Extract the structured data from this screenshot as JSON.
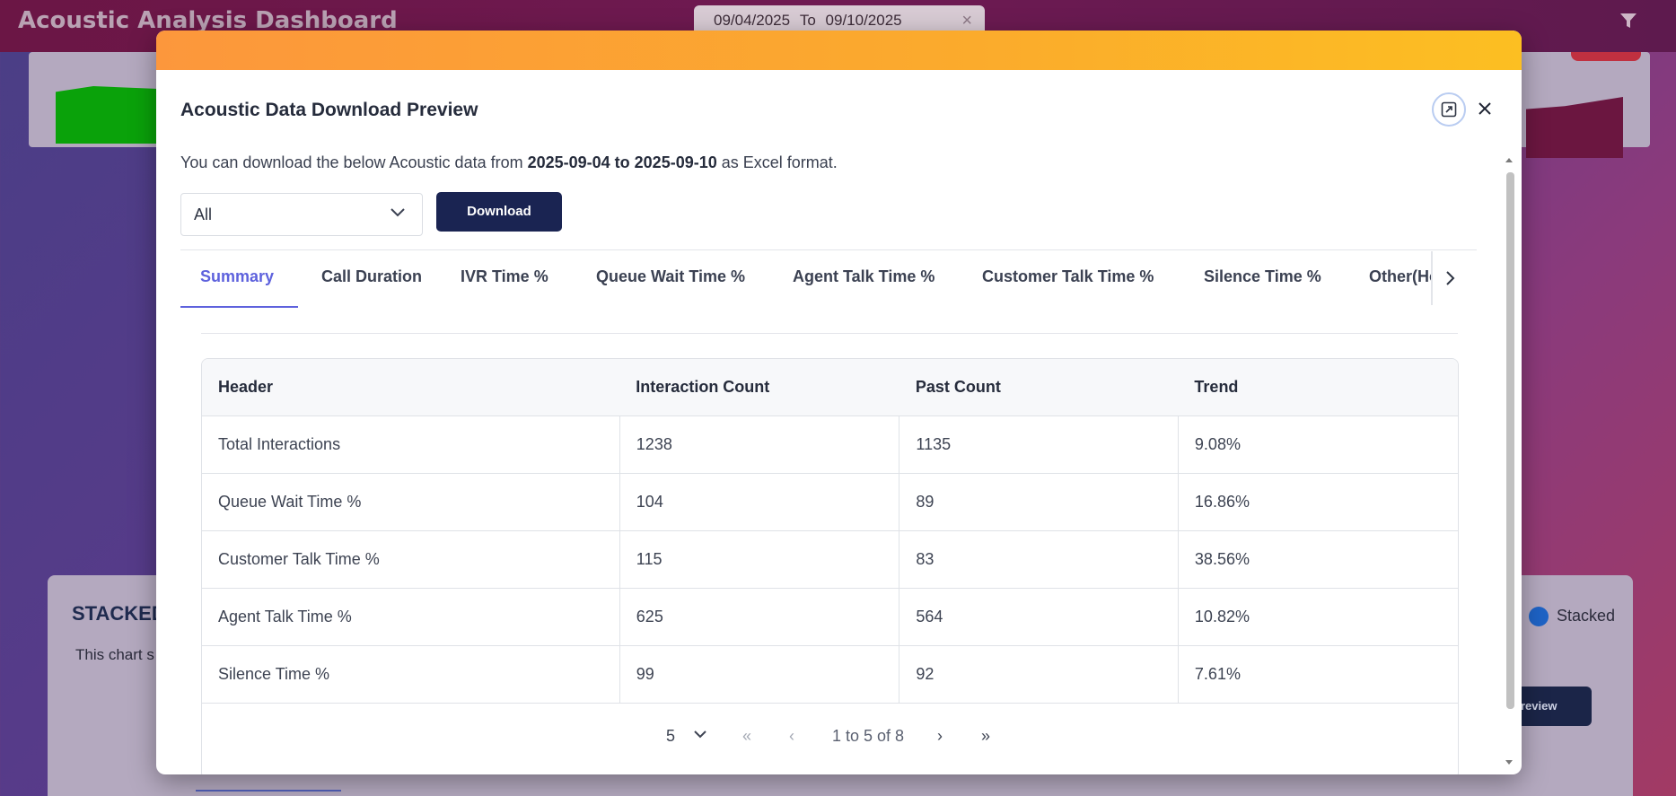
{
  "app": {
    "title": "Acoustic Analysis Dashboard",
    "date_from": "09/04/2025",
    "date_sep": "To",
    "date_to": "09/10/2025",
    "clear_icon": "×"
  },
  "background": {
    "stacked_title": "STACKED",
    "chart_desc": "This chart s",
    "stacked_label": "Stacked",
    "preview_btn": "review"
  },
  "modal": {
    "title": "Acoustic Data Download Preview",
    "desc_prefix": "You can download the below Acoustic data from ",
    "desc_range": "2025-09-04 to 2025-09-10",
    "desc_suffix": " as Excel format.",
    "select_value": "All",
    "download_label": "Download",
    "tabs": [
      {
        "label": "Summary",
        "active": true
      },
      {
        "label": "Call Duration"
      },
      {
        "label": "IVR Time %"
      },
      {
        "label": "Queue Wait Time %"
      },
      {
        "label": "Agent Talk Time %"
      },
      {
        "label": "Customer Talk Time %"
      },
      {
        "label": "Silence Time %"
      },
      {
        "label": "Other(Hold/No"
      }
    ],
    "table": {
      "headers": [
        "Header",
        "Interaction Count",
        "Past Count",
        "Trend"
      ],
      "rows": [
        [
          "Total Interactions",
          "1238",
          "1135",
          "9.08%"
        ],
        [
          "Queue Wait Time %",
          "104",
          "89",
          "16.86%"
        ],
        [
          "Customer Talk Time %",
          "115",
          "83",
          "38.56%"
        ],
        [
          "Agent Talk Time %",
          "625",
          "564",
          "10.82%"
        ],
        [
          "Silence Time %",
          "99",
          "92",
          "7.61%"
        ]
      ]
    },
    "pager": {
      "page_size": "5",
      "first": "«",
      "prev": "‹",
      "summary": "1 to 5 of 8",
      "next": "›",
      "last": "»"
    }
  },
  "colors": {
    "accent_tab": "#5e62dd",
    "download_btn": "#1a2452",
    "modal_header_gradient": [
      "#fc973c",
      "#fcbf22"
    ]
  }
}
